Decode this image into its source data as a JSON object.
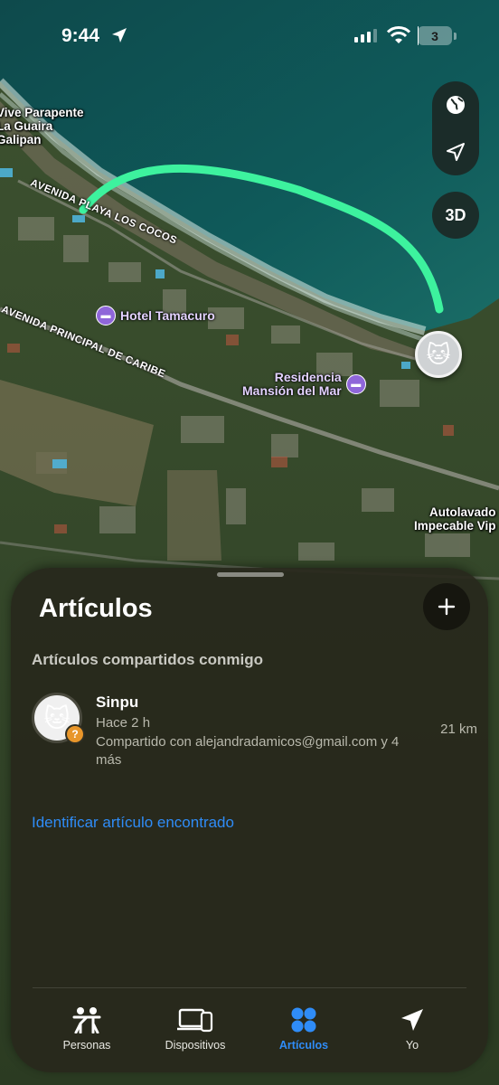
{
  "status_bar": {
    "time": "9:44",
    "battery": "3",
    "battery_level": 0.03
  },
  "map": {
    "labels": {
      "paragliding": "Vive Parapente\nLa Guaira\nGalipan",
      "avenida_playa": "AVENIDA PLAYA LOS COCOS",
      "avenida_principal": "AVENIDA PRINCIPAL DE CARIBE",
      "hotel": "Hotel Tamacuro",
      "residencia": "Residencia\nMansión del Mar",
      "autolavado": "Autolavado\nImpecable Vip"
    },
    "route_color": "#3df29e",
    "three_d_label": "3D",
    "pin_icon": "cat-face-icon"
  },
  "sheet": {
    "title": "Artículos",
    "section_header": "Artículos compartidos conmigo",
    "item": {
      "name": "Sinpu",
      "time": "Hace 2 h",
      "shared": "Compartido con alejandradamicos@gmail.com y 4 más",
      "distance": "21 km",
      "badge": "?"
    },
    "identify_link": "Identificar artículo encontrado"
  },
  "tabs": [
    {
      "label": "Personas",
      "icon": "people-icon",
      "active": false
    },
    {
      "label": "Dispositivos",
      "icon": "devices-icon",
      "active": false
    },
    {
      "label": "Artículos",
      "icon": "items-icon",
      "active": true
    },
    {
      "label": "Yo",
      "icon": "location-arrow-icon",
      "active": false
    }
  ],
  "colors": {
    "accent": "#2f8cf7",
    "badge": "#e8962a"
  }
}
